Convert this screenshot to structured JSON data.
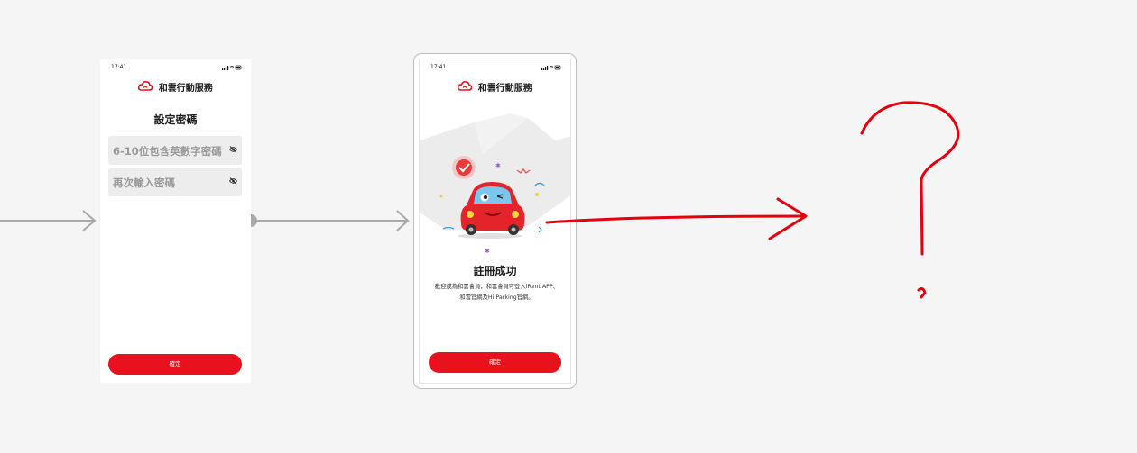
{
  "phone1": {
    "status_time": "17:41",
    "brand_name": "和雲行動服務",
    "title": "設定密碼",
    "password_placeholder": "6-10位包含英數字密碼",
    "confirm_placeholder": "再次輸入密碼",
    "confirm_button": "確定"
  },
  "phone2": {
    "status_time": "17:41",
    "brand_name": "和雲行動服務",
    "title": "註冊成功",
    "description": "歡迎成為和雲會員，和雲會員可登入iRent APP、和雲官網及Hi Parking官網。",
    "confirm_button": "確定"
  },
  "annotation": {
    "question_mark": "?"
  },
  "colors": {
    "brand_red": "#e8111d",
    "arrow_gray": "#a8a8a8",
    "annotation_red": "#e5000b"
  }
}
